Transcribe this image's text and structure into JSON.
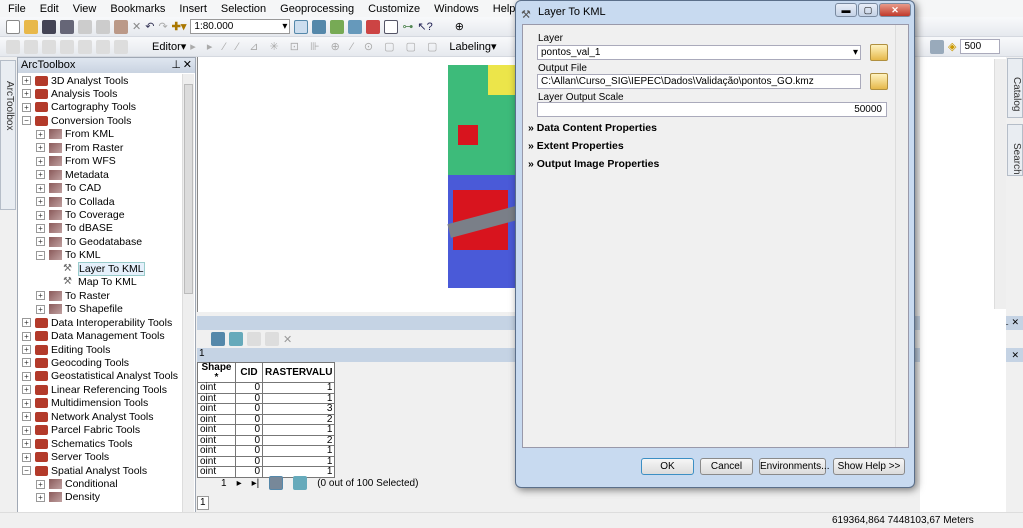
{
  "menu": [
    "File",
    "Edit",
    "View",
    "Bookmarks",
    "Insert",
    "Selection",
    "Geoprocessing",
    "Customize",
    "Windows",
    "Help"
  ],
  "toolbar": {
    "scale": "1:80.000",
    "editor": "Editor",
    "labeling": "Labeling",
    "reference_scale": "500"
  },
  "toolbox": {
    "side_tab": "ArcToolbox",
    "title": "ArcToolbox",
    "items": [
      {
        "label": "3D Analyst Tools",
        "level": 0,
        "state": "+"
      },
      {
        "label": "Analysis Tools",
        "level": 0,
        "state": "+"
      },
      {
        "label": "Cartography Tools",
        "level": 0,
        "state": "+"
      },
      {
        "label": "Conversion Tools",
        "level": 0,
        "state": "-"
      },
      {
        "label": "From KML",
        "level": 1,
        "state": "+"
      },
      {
        "label": "From Raster",
        "level": 1,
        "state": "+"
      },
      {
        "label": "From WFS",
        "level": 1,
        "state": "+"
      },
      {
        "label": "Metadata",
        "level": 1,
        "state": "+"
      },
      {
        "label": "To CAD",
        "level": 1,
        "state": "+"
      },
      {
        "label": "To Collada",
        "level": 1,
        "state": "+"
      },
      {
        "label": "To Coverage",
        "level": 1,
        "state": "+"
      },
      {
        "label": "To dBASE",
        "level": 1,
        "state": "+"
      },
      {
        "label": "To Geodatabase",
        "level": 1,
        "state": "+"
      },
      {
        "label": "To KML",
        "level": 1,
        "state": "-"
      },
      {
        "label": "Layer To KML",
        "level": 2,
        "state": "",
        "selected": true
      },
      {
        "label": "Map To KML",
        "level": 2,
        "state": ""
      },
      {
        "label": "To Raster",
        "level": 1,
        "state": "+"
      },
      {
        "label": "To Shapefile",
        "level": 1,
        "state": "+"
      },
      {
        "label": "Data Interoperability Tools",
        "level": 0,
        "state": "+"
      },
      {
        "label": "Data Management Tools",
        "level": 0,
        "state": "+"
      },
      {
        "label": "Editing Tools",
        "level": 0,
        "state": "+"
      },
      {
        "label": "Geocoding Tools",
        "level": 0,
        "state": "+"
      },
      {
        "label": "Geostatistical Analyst Tools",
        "level": 0,
        "state": "+"
      },
      {
        "label": "Linear Referencing Tools",
        "level": 0,
        "state": "+"
      },
      {
        "label": "Multidimension Tools",
        "level": 0,
        "state": "+"
      },
      {
        "label": "Network Analyst Tools",
        "level": 0,
        "state": "+"
      },
      {
        "label": "Parcel Fabric Tools",
        "level": 0,
        "state": "+"
      },
      {
        "label": "Schematics Tools",
        "level": 0,
        "state": "+"
      },
      {
        "label": "Server Tools",
        "level": 0,
        "state": "+"
      },
      {
        "label": "Spatial Analyst Tools",
        "level": 0,
        "state": "-"
      },
      {
        "label": "Conditional",
        "level": 1,
        "state": "+"
      },
      {
        "label": "Density",
        "level": 1,
        "state": "+"
      }
    ]
  },
  "table": {
    "tab_label": "1",
    "columns": [
      "Shape *",
      "CID",
      "RASTERVALU"
    ],
    "rows": [
      [
        "oint",
        "0",
        "1"
      ],
      [
        "oint",
        "0",
        "1"
      ],
      [
        "oint",
        "0",
        "3"
      ],
      [
        "oint",
        "0",
        "2"
      ],
      [
        "oint",
        "0",
        "1"
      ],
      [
        "oint",
        "0",
        "2"
      ],
      [
        "oint",
        "0",
        "1"
      ],
      [
        "oint",
        "0",
        "1"
      ],
      [
        "oint",
        "0",
        "1"
      ]
    ],
    "page": "1",
    "selection": "(0 out of 100 Selected)",
    "bottom_tab": "1"
  },
  "dialog": {
    "title": "Layer To KML",
    "layer_label": "Layer",
    "layer_value": "pontos_val_1",
    "output_label": "Output File",
    "output_value": "C:\\Allan\\Curso_SIG\\IEPEC\\Dados\\Validação\\pontos_GO.kmz",
    "scale_label": "Layer Output Scale",
    "scale_value": "50000",
    "sections": [
      "Data Content Properties",
      "Extent Properties",
      "Output Image Properties"
    ],
    "buttons": {
      "ok": "OK",
      "cancel": "Cancel",
      "env": "Environments...",
      "help": "Show Help >>"
    }
  },
  "right_tabs": [
    "Catalog",
    "Search"
  ],
  "status": {
    "coords": "619364,864  7448103,67 Meters"
  }
}
